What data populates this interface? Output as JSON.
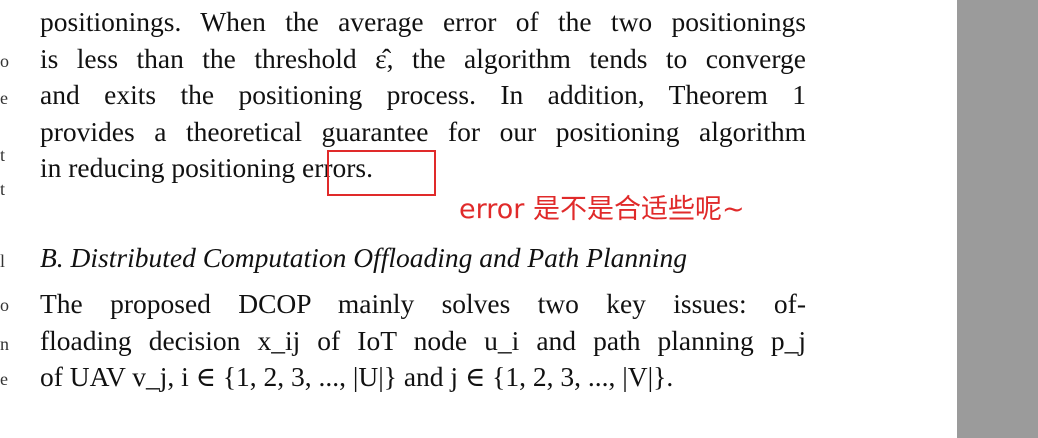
{
  "paragraph1": {
    "lines": [
      "positionings. When the average error of the two positionings",
      "is less than the threshold ε̂, the algorithm tends to converge",
      "and exits the positioning process. In addition, Theorem 1",
      "provides a theoretical guarantee for our positioning algorithm",
      "in reducing positioning errors."
    ]
  },
  "section_heading": "B. Distributed Computation Offloading and Path Planning",
  "paragraph2": {
    "lines": [
      "The proposed DCOP mainly solves two key issues: of-",
      "floading decision x_ij of IoT node u_i and path planning p_j",
      "of UAV v_j, i ∈ {1, 2, 3, ..., |U|} and j ∈ {1, 2, 3, ..., |V|}."
    ]
  },
  "annotation": {
    "comment": "error 是不是合适些呢~",
    "color": "#e02a2a"
  },
  "left_edge_glyphs": [
    "o",
    "e",
    "t",
    "t",
    "l",
    "o",
    "n",
    "e"
  ]
}
